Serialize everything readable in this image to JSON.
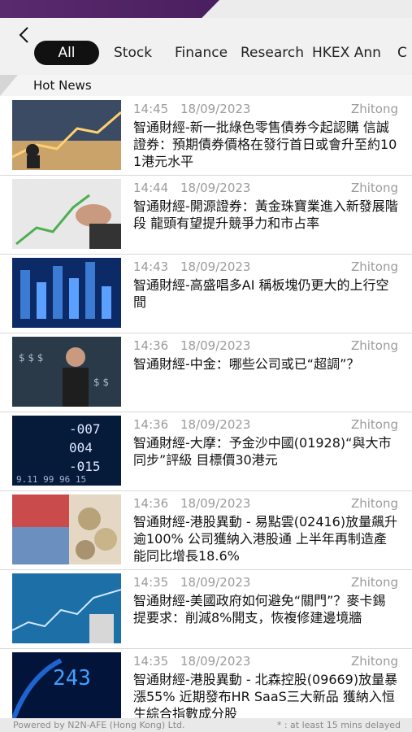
{
  "tabs": [
    {
      "label": "All",
      "active": true
    },
    {
      "label": "Stock",
      "active": false
    },
    {
      "label": "Finance",
      "active": false
    },
    {
      "label": "Research",
      "active": false
    },
    {
      "label": "HKEX Ann",
      "active": false
    },
    {
      "label": "C",
      "active": false
    }
  ],
  "section_title": "Hot News",
  "news": [
    {
      "time": "14:45",
      "date": "18/09/2023",
      "source": "Zhitong",
      "title": "智通財經-新一批綠色零售債券今起認購 信誠證券：預期債券價格在發行首日或會升至約101港元水平"
    },
    {
      "time": "14:44",
      "date": "18/09/2023",
      "source": "Zhitong",
      "title": "智通財經-開源證券：黃金珠寶業進入新發展階段 龍頭有望提升競爭力和市占率"
    },
    {
      "time": "14:43",
      "date": "18/09/2023",
      "source": "Zhitong",
      "title": "智通財經-高盛唱多AI 稱板塊仍更大的上行空間"
    },
    {
      "time": "14:36",
      "date": "18/09/2023",
      "source": "Zhitong",
      "title": "智通財經-中金：哪些公司或已“超調”？"
    },
    {
      "time": "14:36",
      "date": "18/09/2023",
      "source": "Zhitong",
      "title": "智通財經-大摩：予金沙中國(01928)“與大市同步”評級 目標價30港元"
    },
    {
      "time": "14:36",
      "date": "18/09/2023",
      "source": "Zhitong",
      "title": "智通財經-港股異動 - 易點雲(02416)放量飆升逾100% 公司獲納入港股通 上半年再制造產能同比增長18.6%"
    },
    {
      "time": "14:35",
      "date": "18/09/2023",
      "source": "Zhitong",
      "title": "智通財經-美國政府如何避免“關門”？麥卡錫提要求：削減8%開支，恢複修建邊境牆"
    },
    {
      "time": "14:35",
      "date": "18/09/2023",
      "source": "Zhitong",
      "title": "智通財經-港股異動 - 北森控股(09669)放量暴漲55% 近期發布HR SaaS三大新品 獲納入恒生綜合指數成分股"
    }
  ],
  "footer": {
    "left": "Powered by N2N-AFE (Hong Kong) Ltd.",
    "right": "* : at least 15 mins delayed"
  },
  "colors": {
    "accent": "#4a1f5f",
    "active_tab_bg": "#111111",
    "meta_text": "#9b9b9b"
  },
  "icons": {
    "back": "chevron-left-icon"
  }
}
